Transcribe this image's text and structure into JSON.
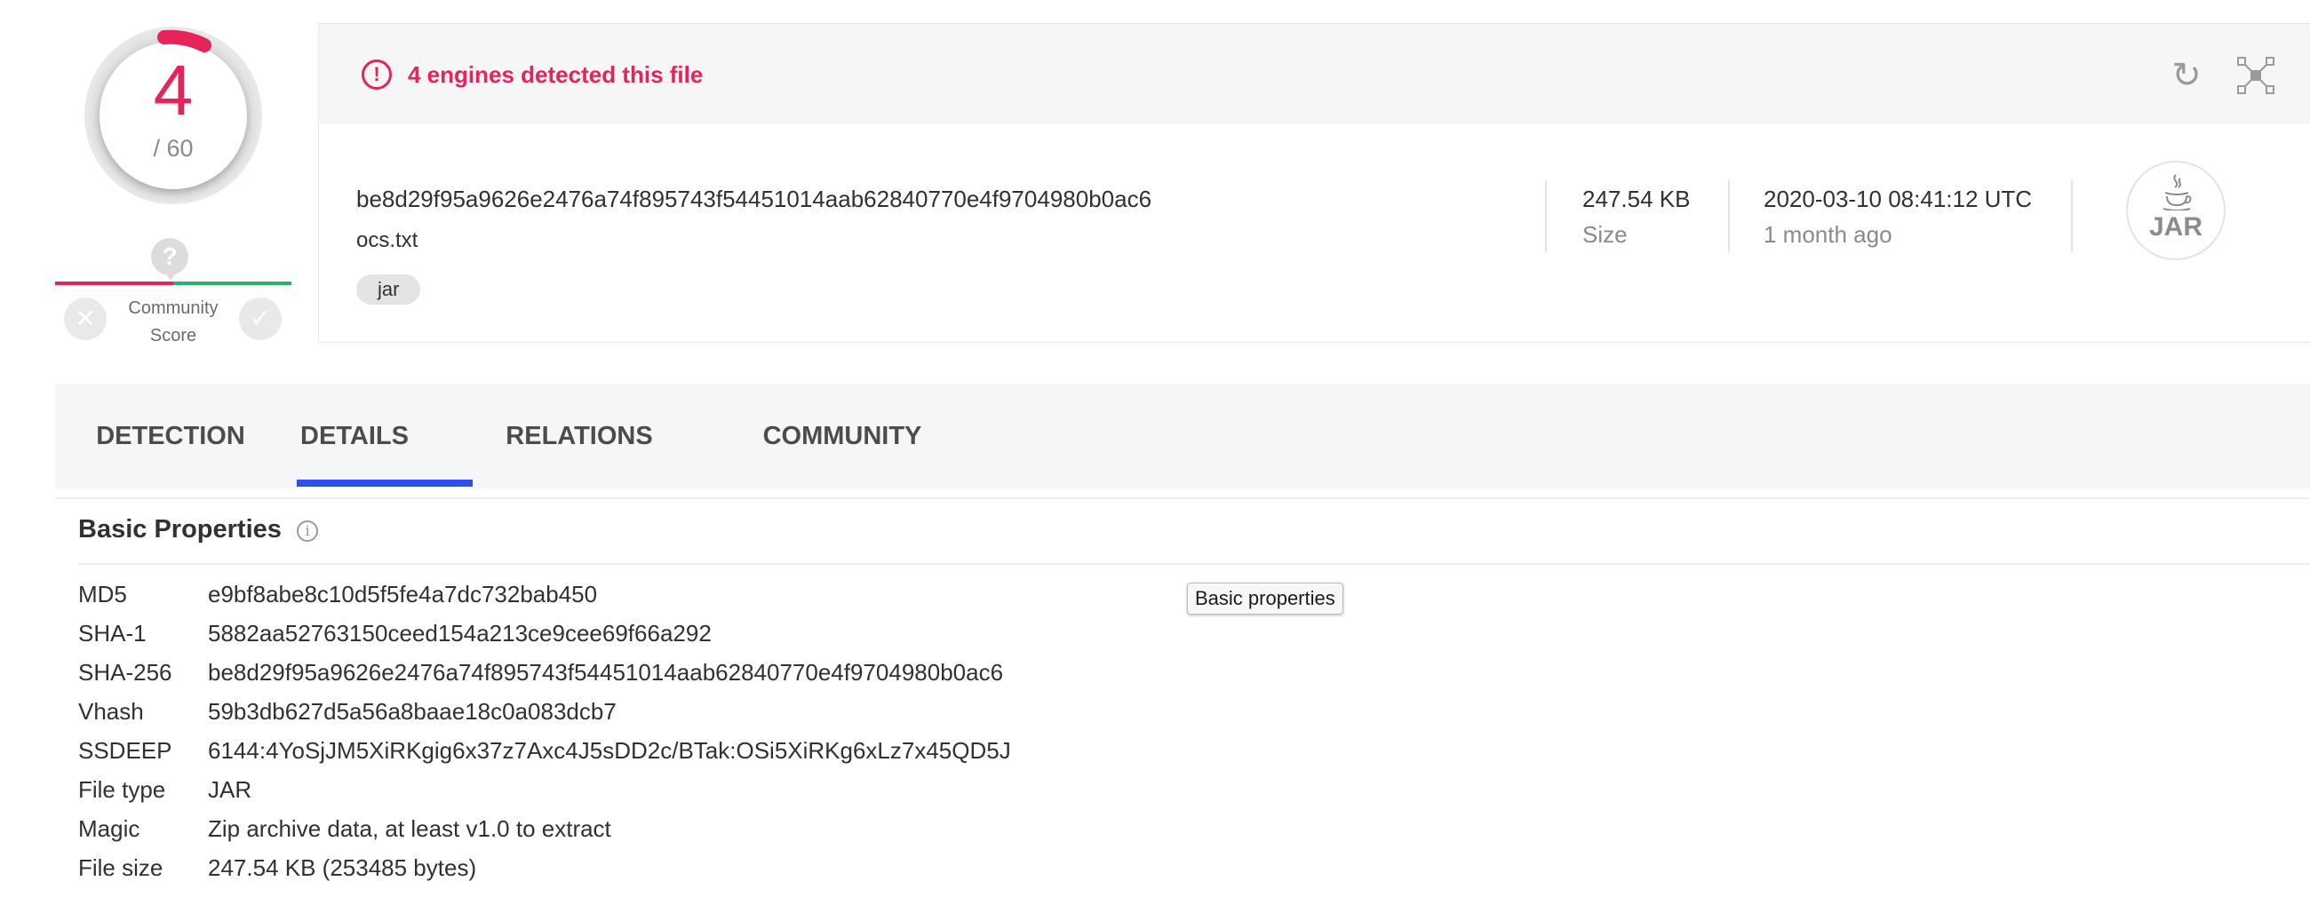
{
  "score": {
    "detections": "4",
    "total": "/ 60",
    "community_label": "Community Score",
    "community_question": "?",
    "vote_down": "✕",
    "vote_up": "✓",
    "colors": {
      "malicious": "#e6245b",
      "harmless": "#26b36b",
      "ring": "#d6d6d6"
    }
  },
  "alert": {
    "icon": "!",
    "text": "4 engines detected this file",
    "reanalyze_icon": "↻"
  },
  "file": {
    "hash": "be8d29f95a9626e2476a74f895743f54451014aab62840770e4f9704980b0ac6",
    "name": "ocs.txt",
    "tag": "jar",
    "size_value": "247.54 KB",
    "size_label": "Size",
    "date_value": "2020-03-10 08:41:12 UTC",
    "date_ago": "1 month ago",
    "type_icon_text": "JAR"
  },
  "tabs": [
    {
      "label": "DETECTION",
      "active": false
    },
    {
      "label": "DETAILS",
      "active": true
    },
    {
      "label": "RELATIONS",
      "active": false
    },
    {
      "label": "COMMUNITY",
      "active": false
    }
  ],
  "basic_properties": {
    "title": "Basic Properties",
    "info_icon": "i",
    "tooltip": "Basic properties",
    "rows": [
      {
        "key": "MD5",
        "value": "e9bf8abe8c10d5f5fe4a7dc732bab450"
      },
      {
        "key": "SHA-1",
        "value": "5882aa52763150ceed154a213ce9cee69f66a292"
      },
      {
        "key": "SHA-256",
        "value": "be8d29f95a9626e2476a74f895743f54451014aab62840770e4f9704980b0ac6"
      },
      {
        "key": "Vhash",
        "value": "59b3db627d5a56a8baae18c0a083dcb7"
      },
      {
        "key": "SSDEEP",
        "value": "6144:4YoSjJM5XiRKgig6x37z7Axc4J5sDD2c/BTak:OSi5XiRKg6xLz7x45QD5J"
      },
      {
        "key": "File type",
        "value": "JAR"
      },
      {
        "key": "Magic",
        "value": "Zip archive data, at least v1.0 to extract"
      },
      {
        "key": "File size",
        "value": "247.54 KB (253485 bytes)"
      }
    ]
  }
}
